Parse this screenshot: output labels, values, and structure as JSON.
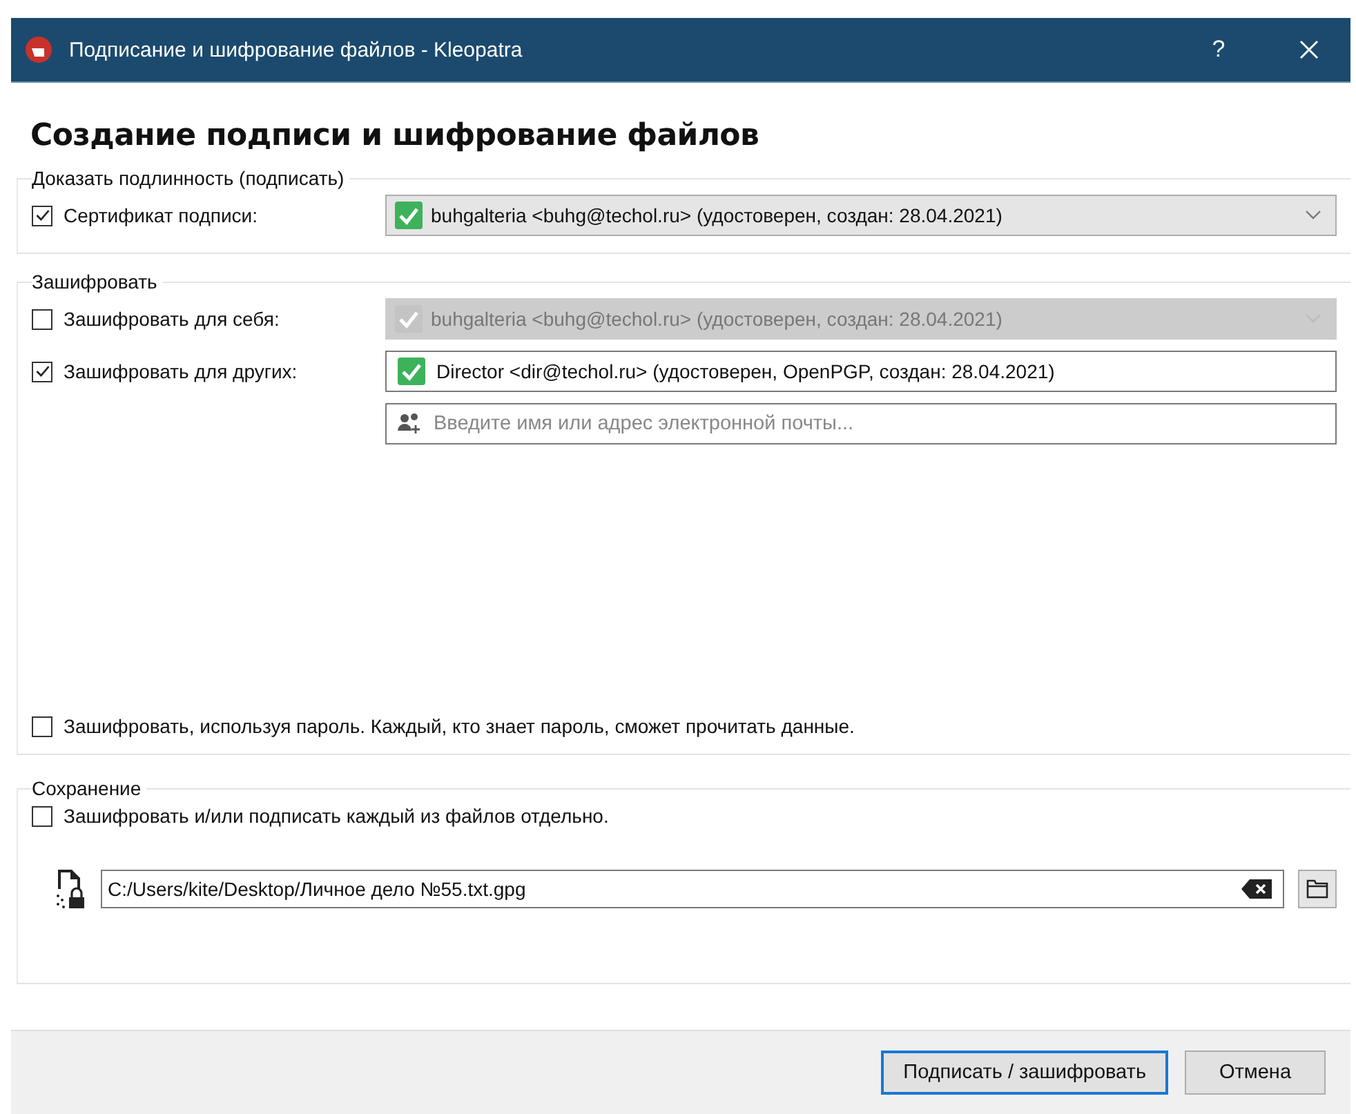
{
  "window": {
    "title": "Подписание и шифрование файлов - Kleopatra",
    "help": "?"
  },
  "heading": "Создание подписи и шифрование файлов",
  "sign": {
    "title": "Доказать подлинность (подписать)",
    "checked": true,
    "label": "Сертификат подписи:",
    "certificate": "buhgalteria <buhg@techol.ru> (удостоверен,  создан: 28.04.2021)",
    "disabled": false
  },
  "encrypt": {
    "title": "Зашифровать",
    "self": {
      "checked": false,
      "label": "Зашифровать для себя:",
      "certificate": "buhgalteria <buhg@techol.ru> (удостоверен,  создан: 28.04.2021)",
      "disabled": true
    },
    "others": {
      "checked": true,
      "label": "Зашифровать для других:",
      "recipient": "Director <dir@techol.ru> (удостоверен, OpenPGP, создан: 28.04.2021)"
    },
    "recipient_field": {
      "placeholder": "Введите имя или адрес электронной почты..."
    },
    "password": {
      "checked": false,
      "label": "Зашифровать, используя пароль. Каждый, кто знает пароль, сможет прочитать данные."
    }
  },
  "output": {
    "title": "Сохранение",
    "separately": {
      "checked": false,
      "label": "Зашифровать и/или подписать каждый из файлов отдельно."
    },
    "path": "C:/Users/kite/Desktop/Личное дело №55.txt.gpg"
  },
  "buttons": [
    {
      "label": "Подписать / зашифровать",
      "default": true
    },
    {
      "label": "Отмена",
      "default": false
    }
  ]
}
